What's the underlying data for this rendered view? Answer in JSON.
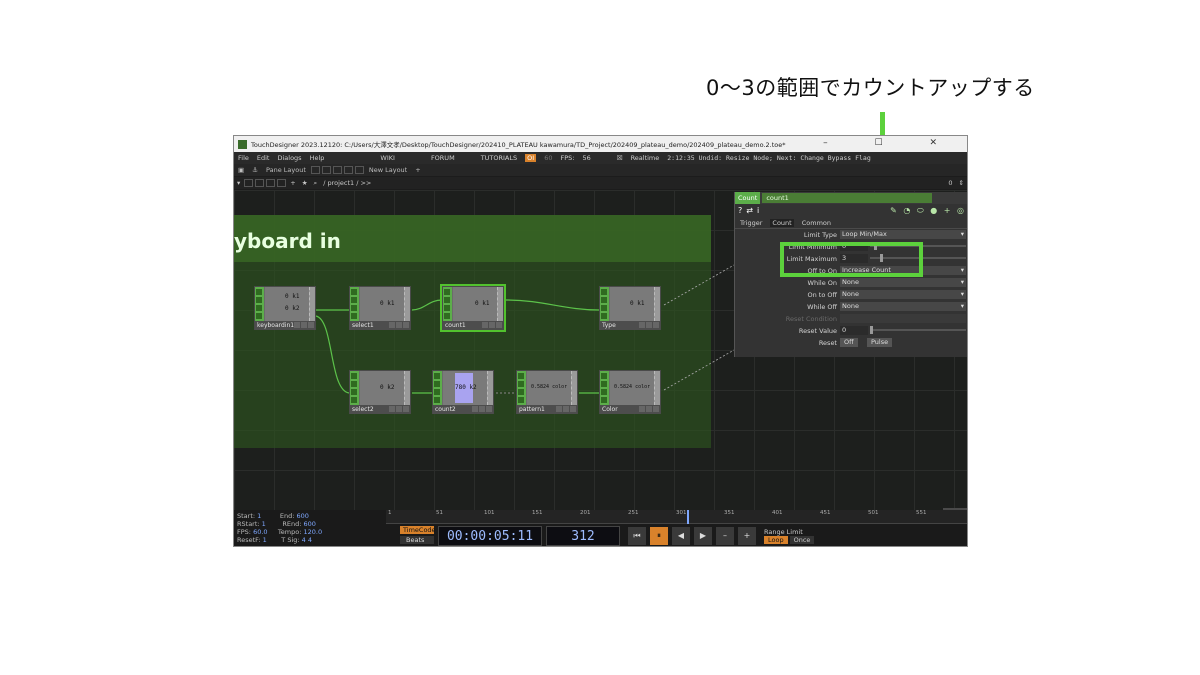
{
  "annotation": {
    "caption": "0〜3の範囲でカウントアップする",
    "highlight_color": "#5cd13c"
  },
  "window": {
    "title": "TouchDesigner 2023.12120: C:/Users/大澤文孝/Desktop/TouchDesigner/202410_PLATEAU kawamura/TD_Project/202409_plateau_demo/202409_plateau_demo.2.toe*",
    "controls": "–  ☐  ✕"
  },
  "menubar": {
    "items": [
      "File",
      "Edit",
      "Dialogs",
      "Help"
    ],
    "wiki": "WIKI",
    "forum": "FORUM",
    "tutorials": "TUTORIALS",
    "oi": "OI",
    "fps_target": "60",
    "fps_label": "FPS:",
    "fps_value": "56",
    "realtime": "Realtime",
    "status": "2:12:35 Undid: Resize Node; Next: Change Bypass Flag"
  },
  "toolbar": {
    "pane_layout": "Pane Layout",
    "new_layout": "New Layout"
  },
  "pathbar": {
    "path": "/ project1 / >>",
    "right_value": "0"
  },
  "network": {
    "annotate_title": "yboard in",
    "nodes": [
      {
        "name": "keyboardin1",
        "v1": "0 k1",
        "v2": "0 k2"
      },
      {
        "name": "select1",
        "v1": "0 k1"
      },
      {
        "name": "count1",
        "v1": "0 k1"
      },
      {
        "name": "Type",
        "v1": "0 k1"
      },
      {
        "name": "select2",
        "v1": "0 k2"
      },
      {
        "name": "count2",
        "v1": "780 k2"
      },
      {
        "name": "pattern1",
        "v1": "0.5824 color"
      },
      {
        "name": "Color",
        "v1": "0.5824 color"
      }
    ],
    "corner_letter": "C"
  },
  "params": {
    "op_type": "Count",
    "op_name": "count1",
    "icons": [
      "?",
      "⇄",
      "i"
    ],
    "tabs": [
      "Trigger",
      "Count",
      "Common"
    ],
    "active_tab": "Count",
    "rows": [
      {
        "label": "Limit Type",
        "value": "Loop Min/Max"
      },
      {
        "label": "Limit Minimum",
        "value": "0"
      },
      {
        "label": "Limit Maximum",
        "value": "3"
      },
      {
        "label": "Off to On",
        "value": "Increase Count"
      },
      {
        "label": "While On",
        "value": "None"
      },
      {
        "label": "On to Off",
        "value": "None"
      },
      {
        "label": "While Off",
        "value": "None"
      },
      {
        "label": "Reset Condition",
        "value": ""
      },
      {
        "label": "Reset Value",
        "value": "0"
      },
      {
        "label": "Reset",
        "value": "Off",
        "button": "Pulse"
      }
    ]
  },
  "timeline": {
    "info": [
      {
        "k": "Start:",
        "v": "1",
        "k2": "End:",
        "v2": "600"
      },
      {
        "k": "RStart:",
        "v": "1",
        "k2": "REnd:",
        "v2": "600"
      },
      {
        "k": "FPS:",
        "v": "60.0",
        "k2": "Tempo:",
        "v2": "120.0"
      },
      {
        "k": "ResetF:",
        "v": "1",
        "k2": "T Sig:",
        "v2": "4     4"
      }
    ],
    "ticks": [
      "1",
      "51",
      "101",
      "151",
      "201",
      "251",
      "301",
      "351",
      "401",
      "451",
      "501",
      "551"
    ],
    "playhead_frame": 312,
    "mode_on": "TimeCode",
    "mode_off": "Beats",
    "timecode": "00:00:05:11",
    "frame": "312",
    "buttons": [
      "⏮",
      "⏸",
      "◀",
      "▶",
      "–",
      "+"
    ],
    "range_label": "Range Limit",
    "loop": "Loop",
    "once": "Once"
  }
}
